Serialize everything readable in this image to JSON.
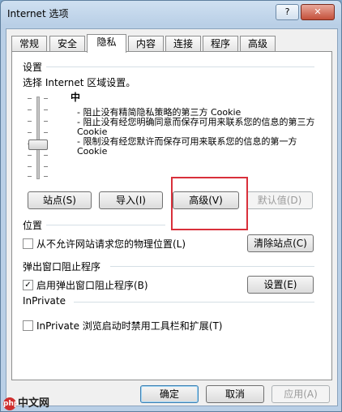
{
  "window": {
    "title": "Internet 选项",
    "help_label": "?",
    "close_label": "✕"
  },
  "tabs": [
    {
      "label": "常规"
    },
    {
      "label": "安全"
    },
    {
      "label": "隐私"
    },
    {
      "label": "内容"
    },
    {
      "label": "连接"
    },
    {
      "label": "程序"
    },
    {
      "label": "高级"
    }
  ],
  "settings": {
    "heading": "设置",
    "instruction": "选择 Internet 区域设置。",
    "level": "中",
    "description": [
      "- 阻止没有精简隐私策略的第三方 Cookie",
      "- 阻止没有经您明确同意而保存可用来联系您的信息的第三方 Cookie",
      "- 限制没有经您默许而保存可用来联系您的信息的第一方 Cookie"
    ],
    "buttons": {
      "sites": "站点(S)",
      "import": "导入(I)",
      "advanced": "高级(V)",
      "default": "默认值(D)"
    }
  },
  "location": {
    "heading": "位置",
    "checkbox_label": "从不允许网站请求您的物理位置(L)",
    "checked": false,
    "clear_button": "清除站点(C)"
  },
  "popup": {
    "heading": "弹出窗口阻止程序",
    "checkbox_label": "启用弹出窗口阻止程序(B)",
    "checked": true,
    "settings_button": "设置(E)"
  },
  "inprivate": {
    "heading": "InPrivate",
    "checkbox_label": "InPrivate 浏览启动时禁用工具栏和扩展(T)",
    "checked": false
  },
  "footer": {
    "ok": "确定",
    "cancel": "取消",
    "apply": "应用(A)"
  },
  "watermark": {
    "logo_text": "php",
    "text": "中文网"
  },
  "colors": {
    "highlight_border": "#d9303b"
  }
}
